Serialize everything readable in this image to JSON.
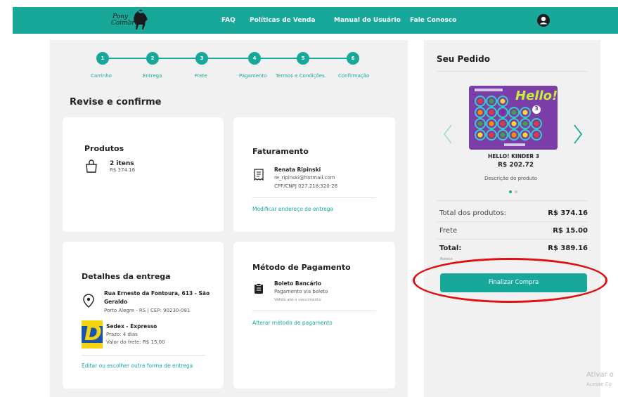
{
  "header": {
    "logo_line1": "Pony",
    "logo_line2": "Coimbra",
    "nav": [
      "FAQ",
      "Políticas de Venda",
      "Manual do Usuário",
      "Fale Conosco"
    ]
  },
  "steps": [
    {
      "num": "1",
      "label": "Carrinho"
    },
    {
      "num": "2",
      "label": "Entrega"
    },
    {
      "num": "3",
      "label": "Frete"
    },
    {
      "num": "4",
      "label": "Pagamento"
    },
    {
      "num": "5",
      "label": "Termos e Condições"
    },
    {
      "num": "6",
      "label": "Confirmação"
    }
  ],
  "page_title": "Revise e confirme",
  "produtos": {
    "title": "Produtos",
    "count": "2 itens",
    "price": "R$ 374.16"
  },
  "faturamento": {
    "title": "Faturamento",
    "name": "Renata Ripinski",
    "email": "re_ripinski@hotmail.com",
    "doc": "CPF/CNPJ 027.218.320-26",
    "link": "Modificar endereço de entrega"
  },
  "entrega": {
    "title": "Detalhes da entrega",
    "address_line1": "Rua Ernesto da Fontoura, 613 - São",
    "address_line2": "Geraldo",
    "address_line3": "Porto Alegre - RS | CEP: 90230-091",
    "carrier_logo": "D",
    "carrier_name": "Sedex - Expresso",
    "carrier_term": "Prazo: 4 dias",
    "carrier_cost": "Valor do frete: R$ 15,00",
    "link": "Editar ou escolher outra forma de entrega"
  },
  "pagamento": {
    "title": "Método de Pagamento",
    "method": "Boleto Bancário",
    "desc": "Pagamento via boleto",
    "note": "Válido até o vencimento",
    "link": "Alterar método de pagamento"
  },
  "pedido": {
    "title": "Seu Pedido",
    "product_name": "HELLO! KINDER 3",
    "product_price": "R$ 202.72",
    "product_desc": "Descrição do produto",
    "box_text": "Hello!",
    "box_number": "3",
    "rows": [
      {
        "label": "Total dos produtos:",
        "value": "R$ 374.16"
      },
      {
        "label": "Frete",
        "value": "R$ 15.00"
      },
      {
        "label": "Total:",
        "value": "R$ 389.16"
      }
    ],
    "payment_hint": "Boleto",
    "button": "Finalizar Compra",
    "carousel_pages": 2,
    "carousel_active": 1
  },
  "watermark": {
    "line1": "Ativar o",
    "line2": "Acesse Co"
  },
  "colors": {
    "accent": "#17a89a",
    "highlight": "#e01010"
  }
}
